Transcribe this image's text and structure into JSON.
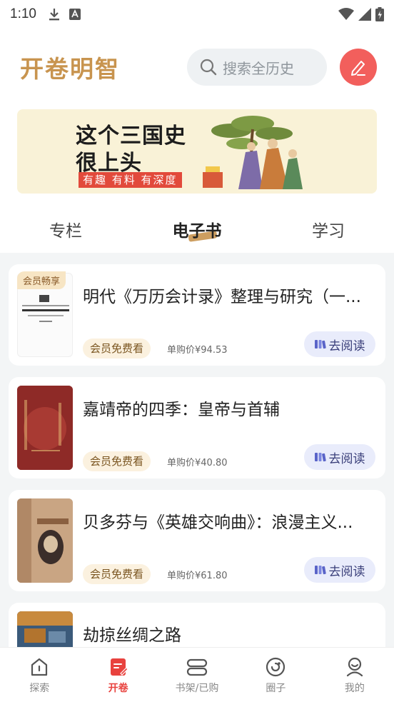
{
  "status_bar": {
    "time": "1:10"
  },
  "header": {
    "logo": "开卷明智",
    "search_placeholder": "搜索全历史"
  },
  "banner": {
    "line1": "这个三国史",
    "line2": "很上头",
    "tagline": "有趣 有料 有深度"
  },
  "tabs": [
    {
      "label": "专栏",
      "active": false
    },
    {
      "label": "电子书",
      "active": true
    },
    {
      "label": "学习",
      "active": false
    }
  ],
  "books": [
    {
      "title": "明代《万历会计录》整理与研究（一...",
      "member_chip": "会员畅享",
      "vip_label": "会员免费看",
      "price": "单购价¥94.53",
      "read_label": "去阅读",
      "cover": "cover-white"
    },
    {
      "title": "嘉靖帝的四季：皇帝与首辅",
      "member_chip": "",
      "vip_label": "会员免费看",
      "price": "单购价¥40.80",
      "read_label": "去阅读",
      "cover": "cover-red"
    },
    {
      "title": "贝多芬与《英雄交响曲》：浪漫主义...",
      "member_chip": "",
      "vip_label": "会员免费看",
      "price": "单购价¥61.80",
      "read_label": "去阅读",
      "cover": "cover-tan"
    },
    {
      "title": "劫掠丝绸之路",
      "member_chip": "",
      "vip_label": "",
      "price": "",
      "read_label": "",
      "cover": "cover-blue"
    }
  ],
  "nav": [
    {
      "label": "探索",
      "icon": "explore-icon",
      "active": false
    },
    {
      "label": "开卷",
      "icon": "open-book-icon",
      "active": true
    },
    {
      "label": "书架/已购",
      "icon": "bookshelf-icon",
      "active": false
    },
    {
      "label": "圈子",
      "icon": "circle-icon",
      "active": false
    },
    {
      "label": "我的",
      "icon": "profile-icon",
      "active": false
    }
  ],
  "colors": {
    "accent": "#e8423e",
    "brand_gold": "#c8944f",
    "pen_button": "#f25f5c"
  }
}
